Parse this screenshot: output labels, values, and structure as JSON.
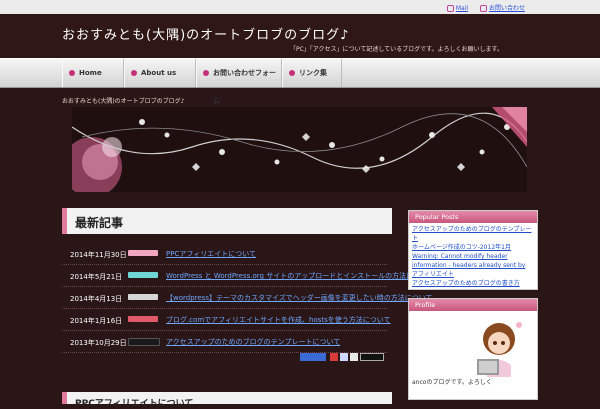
{
  "topbar": {
    "mail": "Mail",
    "link2": "お問い合わせ"
  },
  "header": {
    "title": "おおすみとも(大隅)のオートブロブのブログ♪",
    "description": "「PC」「アクセス」について記述しているブログです。よろしくお願いします。"
  },
  "nav": [
    {
      "label": "Home"
    },
    {
      "label": "About us"
    },
    {
      "label": "お問い合わせフォーム"
    },
    {
      "label": "リンク集"
    }
  ],
  "breadcrumb": "おおすみとも(大隅)のオートブロブのブログ♪",
  "main": {
    "heading": "最新記事",
    "posts": [
      {
        "date": "2014年11月30日",
        "tag_color": "#f2a6c0",
        "title": "PPCアフィリエイトについて"
      },
      {
        "date": "2014年5月21日",
        "tag_color": "#6fd6d6",
        "title": "WordPress と WordPress.org サイトのアップロードとインストールの方法について"
      },
      {
        "date": "2014年4月13日",
        "tag_color": "#d6d6d6",
        "title": "【wordpress】テーマのカスタマイズでヘッダー画像を変更したい時の方法について"
      },
      {
        "date": "2014年1月16日",
        "tag_color": "#e05a6a",
        "title": "ブログ.comでアフィリエイトサイトを作成、hostsを使う方法について"
      },
      {
        "date": "2013年10月29日",
        "tag_color": "#1a1a1a",
        "title": "アクセスアップのためのブログのテンプレートについて"
      }
    ],
    "heading2": "PPCアフィリエイトについて"
  },
  "sidebar": {
    "popular_title": "Popular Posts",
    "popular": [
      "アクセスアップのためのブログのテンプレート",
      "ホームページ作成のコツ-2012年1月",
      "Warning: Cannot modify header",
      "information - headers already sent by",
      "アフィリエイト",
      "アクセスアップのためのブログの書き方"
    ],
    "profile_title": "Profile",
    "profile_text": "ancoのブログです。よろしく"
  }
}
